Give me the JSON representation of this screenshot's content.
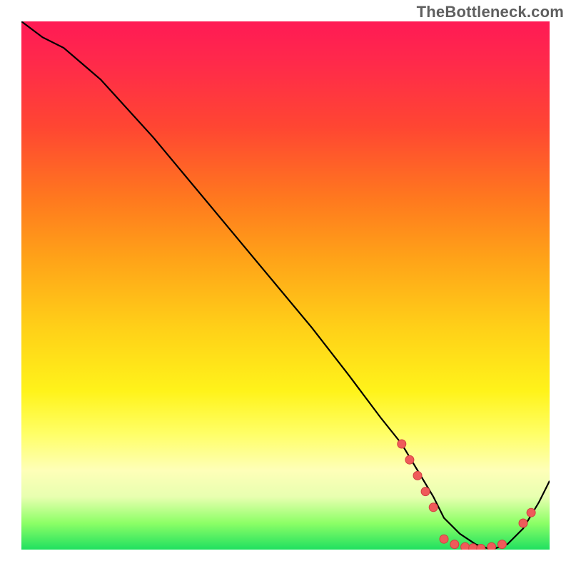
{
  "watermark": "TheBottleneck.com",
  "colors": {
    "line": "#000000",
    "marker_fill": "#ef5a5a",
    "marker_stroke": "#d13f3f"
  },
  "chart_data": {
    "type": "line",
    "title": "",
    "xlabel": "",
    "ylabel": "",
    "xlim": [
      0,
      100
    ],
    "ylim": [
      0,
      100
    ],
    "series": [
      {
        "name": "curve",
        "x": [
          0,
          4,
          8,
          15,
          25,
          35,
          45,
          55,
          62,
          68,
          72,
          75,
          78,
          80,
          83,
          86,
          89,
          92,
          95,
          98,
          100
        ],
        "y": [
          100,
          97,
          95,
          89,
          78,
          66,
          54,
          42,
          33,
          25,
          20,
          15,
          10,
          6,
          3,
          1,
          0,
          1,
          4,
          9,
          13
        ]
      }
    ],
    "markers": [
      {
        "x": 72,
        "y": 20
      },
      {
        "x": 73.5,
        "y": 17
      },
      {
        "x": 75,
        "y": 14
      },
      {
        "x": 76.5,
        "y": 11
      },
      {
        "x": 78,
        "y": 8
      },
      {
        "x": 80,
        "y": 2
      },
      {
        "x": 82,
        "y": 1
      },
      {
        "x": 84,
        "y": 0.5
      },
      {
        "x": 85.5,
        "y": 0.3
      },
      {
        "x": 87,
        "y": 0.2
      },
      {
        "x": 89,
        "y": 0.5
      },
      {
        "x": 91,
        "y": 1
      },
      {
        "x": 95,
        "y": 5
      },
      {
        "x": 96.5,
        "y": 7
      }
    ]
  }
}
